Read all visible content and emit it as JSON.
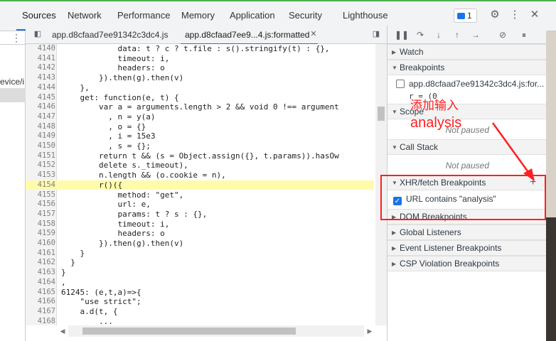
{
  "main_tabs": [
    {
      "label": "Sources",
      "active": true
    },
    {
      "label": "Network"
    },
    {
      "label": "Performance"
    },
    {
      "label": "Memory"
    },
    {
      "label": "Application"
    },
    {
      "label": "Security"
    },
    {
      "label": "Lighthouse"
    }
  ],
  "issues_count": "1",
  "left_panel": {
    "partial_item": "evice/i"
  },
  "file_tabs": [
    {
      "label": "app.d8cfaad7ee91342c3dc4.js"
    },
    {
      "label": "app.d8cfaad7ee9...4.js:formatted",
      "active": true
    }
  ],
  "code_lines": [
    {
      "n": "4140",
      "t": "            data: t ? c ? t.file : s().stringify(t) : {},"
    },
    {
      "n": "4141",
      "t": "            timeout: i,"
    },
    {
      "n": "4142",
      "t": "            headers: o"
    },
    {
      "n": "4143",
      "t": "        }).then(g).then(v)"
    },
    {
      "n": "4144",
      "t": "    },"
    },
    {
      "n": "4145",
      "t": "    get: function(e, t) {"
    },
    {
      "n": "4146",
      "t": "        var a = arguments.length > 2 && void 0 !== argument"
    },
    {
      "n": "4147",
      "t": "          , n = y(a)"
    },
    {
      "n": "4148",
      "t": "          , o = {}"
    },
    {
      "n": "4149",
      "t": "          , i = 15e3"
    },
    {
      "n": "4150",
      "t": "          , s = {};"
    },
    {
      "n": "4151",
      "t": "        return t && (s = Object.assign({}, t.params)).hasOw"
    },
    {
      "n": "4152",
      "t": "        delete s._timeout),"
    },
    {
      "n": "4153",
      "t": "        n.length && (o.cookie = n),"
    },
    {
      "n": "4154",
      "t": "        r()({",
      "highlight": true
    },
    {
      "n": "4155",
      "t": "            method: \"get\","
    },
    {
      "n": "4156",
      "t": "            url: e,"
    },
    {
      "n": "4157",
      "t": "            params: t ? s : {},"
    },
    {
      "n": "4158",
      "t": "            timeout: i,"
    },
    {
      "n": "4159",
      "t": "            headers: o"
    },
    {
      "n": "4160",
      "t": "        }).then(g).then(v)"
    },
    {
      "n": "4161",
      "t": "    }"
    },
    {
      "n": "4162",
      "t": "  }"
    },
    {
      "n": "4163",
      "t": "}"
    },
    {
      "n": "4164",
      "t": ","
    },
    {
      "n": "4165",
      "t": "61245: (e,t,a)=>{"
    },
    {
      "n": "4166",
      "t": "    \"use strict\";"
    },
    {
      "n": "4167",
      "t": "    a.d(t, {"
    },
    {
      "n": "4168",
      "t": "        ..."
    }
  ],
  "sidebar": {
    "watch": "Watch",
    "breakpoints": "Breakpoints",
    "breakpoint_file": "app.d8cfaad7ee91342c3dc4.js:for...",
    "breakpoint_code": "r = (0",
    "scope": "Scope",
    "scope_status": "Not paused",
    "call_stack": "Call Stack",
    "call_stack_status": "Not paused",
    "xhr_fetch": "XHR/fetch Breakpoints",
    "xhr_rule": "URL contains \"analysis\"",
    "dom_breakpoints": "DOM Breakpoints",
    "global_listeners": "Global Listeners",
    "event_listener_breakpoints": "Event Listener Breakpoints",
    "csp_violation_breakpoints": "CSP Violation Breakpoints"
  },
  "annotation": {
    "line1": "添加输入",
    "line2": "analysis",
    "color": "#ff1f1f"
  },
  "colors": {
    "accent": "#1a73e8",
    "highlight": "#fffbaa"
  }
}
